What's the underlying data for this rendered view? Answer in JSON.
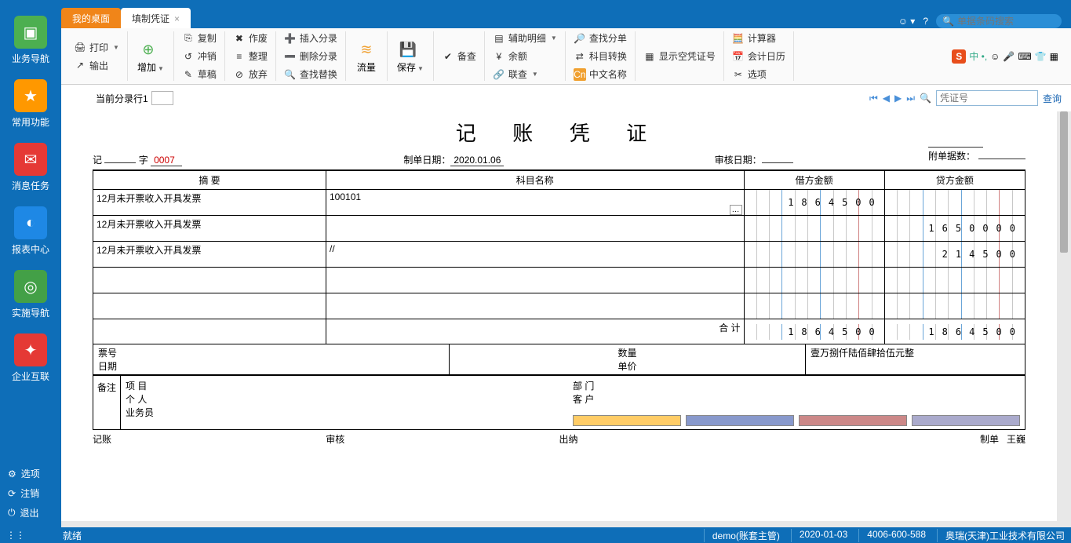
{
  "tabs": {
    "desktop": "我的桌面",
    "voucher": "填制凭证"
  },
  "search_top_placeholder": "单据条码搜索",
  "sidebar": {
    "items": [
      {
        "label": "业务导航",
        "color": "#4caf50"
      },
      {
        "label": "常用功能",
        "color": "#ff9800"
      },
      {
        "label": "消息任务",
        "color": "#e53935"
      },
      {
        "label": "报表中心",
        "color": "#1e88e5"
      },
      {
        "label": "实施导航",
        "color": "#43a047"
      },
      {
        "label": "企业互联",
        "color": "#e53935"
      }
    ],
    "options": {
      "opt": "选项",
      "logout": "注销",
      "exit": "退出"
    }
  },
  "ribbon": {
    "print": "打印",
    "export": "输出",
    "add": "增加",
    "copy": "复制",
    "reverse": "冲销",
    "draft": "草稿",
    "void": "作废",
    "tidy": "整理",
    "abandon": "放弃",
    "insline": "插入分录",
    "delline": "删除分录",
    "findrep": "查找替换",
    "flow": "流量",
    "save": "保存",
    "audit": "备查",
    "assist": "辅助明细",
    "balance": "余额",
    "linkquery": "联查",
    "findsplit": "查找分单",
    "subjtrans": "科目转换",
    "cnname": "中文名称",
    "showempty": "显示空凭证号",
    "calc": "计算器",
    "caldate": "会计日历",
    "option": "选项"
  },
  "inforow": {
    "cur_line": "当前分录行1",
    "search_placeholder": "凭证号",
    "query": "查询"
  },
  "voucher": {
    "title": "记 账 凭 证",
    "prefix": "记",
    "word": "字",
    "num": "0007",
    "makedate_lbl": "制单日期：",
    "makedate": "2020.01.06",
    "auditdate_lbl": "审核日期：",
    "attach_lbl": "附单据数：",
    "cols": {
      "summary": "摘 要",
      "subject": "科目名称",
      "debit": "借方金额",
      "credit": "贷方金额"
    },
    "rows": [
      {
        "summary": "12月未开票收入开具发票",
        "subject": "100101",
        "debit": "1864500",
        "credit": ""
      },
      {
        "summary": "12月未开票收入开具发票",
        "subject": "",
        "debit": "",
        "credit": "1650000"
      },
      {
        "summary": "12月未开票收入开具发票",
        "subject": "//",
        "debit": "",
        "credit": "214500"
      },
      {
        "summary": "",
        "subject": "",
        "debit": "",
        "credit": ""
      },
      {
        "summary": "",
        "subject": "",
        "debit": "",
        "credit": ""
      }
    ],
    "total_lbl": "合 计",
    "total_debit": "1864500",
    "total_credit": "1864500",
    "total_cn": "壹万捌仟陆佰肆拾伍元整",
    "extra": {
      "ticket": "票号",
      "date": "日期",
      "qty": "数量",
      "price": "单价"
    },
    "remark": {
      "label": "备注",
      "project": "项 目",
      "dept": "部 门",
      "person": "个 人",
      "customer": "客 户",
      "sales": "业务员"
    },
    "sign": {
      "bookkeep": "记账",
      "audit": "审核",
      "cashier": "出纳",
      "maker": "制单",
      "maker_name": "王巍"
    }
  },
  "statusbar": {
    "ready": "就绪",
    "user": "demo(账套主管)",
    "date": "2020-01-03",
    "phone": "4006-600-588",
    "company": "奥瑞(天津)工业技术有限公司"
  }
}
